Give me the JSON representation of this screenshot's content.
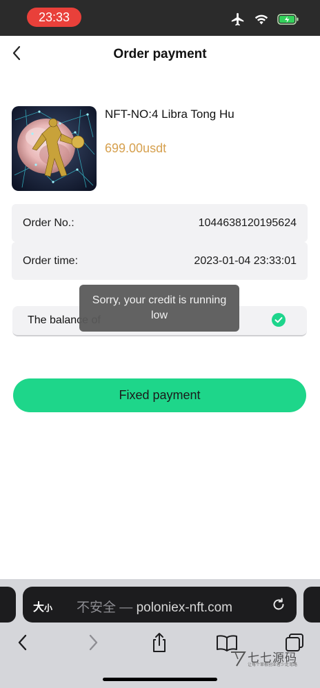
{
  "status_bar": {
    "time": "23:33"
  },
  "header": {
    "title": "Order payment"
  },
  "product": {
    "name": "NFT-NO:4 Libra Tong Hu",
    "price": "699.00usdt"
  },
  "order": {
    "number_label": "Order No.:",
    "number_value": "1044638120195624",
    "time_label": "Order time:",
    "time_value": "2023-01-04 23:33:01"
  },
  "payment_option": {
    "label": "The balance of",
    "selected": true
  },
  "toast": {
    "message": "Sorry, your credit is running low"
  },
  "pay_button": {
    "label": "Fixed payment"
  },
  "browser": {
    "text_size_big": "大",
    "text_size_small": "小",
    "insecure_label": "不安全 —",
    "domain": "poloniex-nft.com"
  },
  "watermark": {
    "main": "七七源码",
    "sub": "让每个草根创业者少走弯路"
  },
  "colors": {
    "accent": "#1ed68a",
    "price": "#d6a04e",
    "toast_bg": "#5a5a5a",
    "time_pill": "#e9403a"
  },
  "icons": [
    "airplane-icon",
    "wifi-icon",
    "battery-icon",
    "back-icon",
    "check-icon",
    "reload-icon",
    "back-arrow-icon",
    "forward-arrow-icon",
    "share-icon",
    "bookmarks-icon",
    "tabs-icon"
  ]
}
